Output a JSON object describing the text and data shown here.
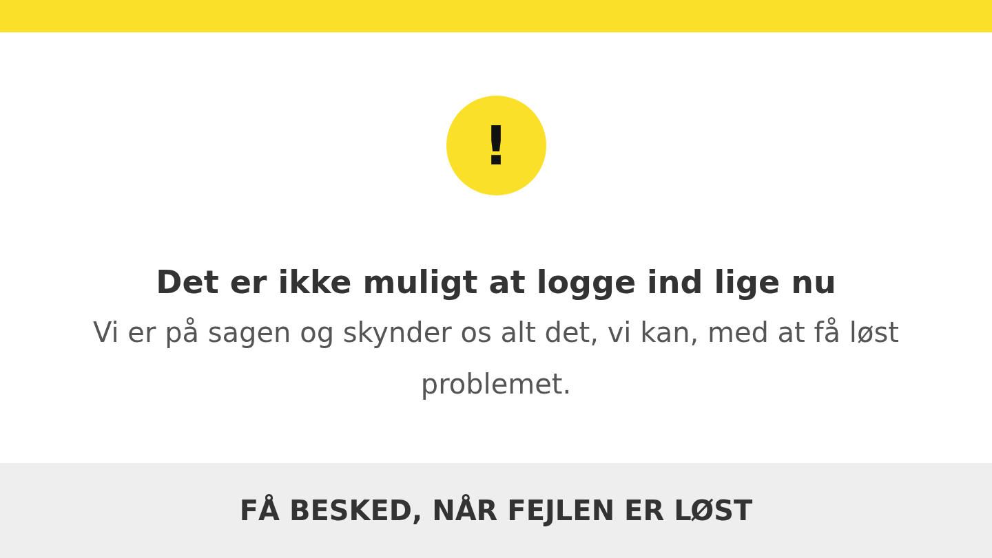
{
  "alert": {
    "icon_text": "!",
    "title": "Det er ikke muligt at logge ind lige nu",
    "message": "Vi er på sagen og skynder os alt det, vi kan, med at få løst problemet."
  },
  "action_button": {
    "label": "FÅ BESKED, NÅR FEJLEN ER LØST"
  }
}
